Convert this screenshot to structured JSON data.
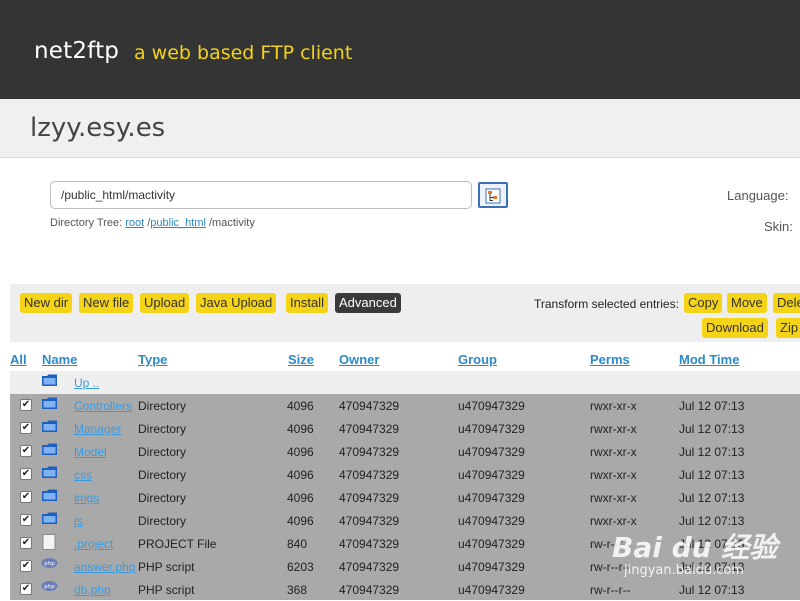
{
  "header": {
    "app_name": "net2ftp",
    "tagline": "a web based FTP client"
  },
  "host": {
    "title": "lzyy.esy.es"
  },
  "directory": {
    "path": "/public_html/mactivity",
    "tree_label": "Directory Tree:",
    "tree": [
      "root",
      "public_html",
      "/mactivity"
    ]
  },
  "settings": {
    "language_label": "Language:",
    "skin_label": "Skin:"
  },
  "toolbar": {
    "buttons": [
      "New dir",
      "New file",
      "Upload",
      "Java Upload",
      "Install",
      "Advanced"
    ],
    "transform_label": "Transform selected entries:",
    "transform_buttons": [
      "Copy",
      "Move",
      "Dele",
      "Download",
      "Zip"
    ]
  },
  "columns": [
    "All",
    "Name",
    "Type",
    "Size",
    "Owner",
    "Group",
    "Perms",
    "Mod Time"
  ],
  "up_label": "Up ..",
  "files": [
    {
      "name": "Controllers",
      "type": "Directory",
      "size": "4096",
      "owner": "470947329",
      "group": "u470947329",
      "perms": "rwxr-xr-x",
      "mtime": "Jul 12 07:13",
      "icon": "folder-icon"
    },
    {
      "name": "Manager",
      "type": "Directory",
      "size": "4096",
      "owner": "470947329",
      "group": "u470947329",
      "perms": "rwxr-xr-x",
      "mtime": "Jul 12 07:13",
      "icon": "folder-icon"
    },
    {
      "name": "Model",
      "type": "Directory",
      "size": "4096",
      "owner": "470947329",
      "group": "u470947329",
      "perms": "rwxr-xr-x",
      "mtime": "Jul 12 07:13",
      "icon": "folder-icon"
    },
    {
      "name": "css",
      "type": "Directory",
      "size": "4096",
      "owner": "470947329",
      "group": "u470947329",
      "perms": "rwxr-xr-x",
      "mtime": "Jul 12 07:13",
      "icon": "folder-icon"
    },
    {
      "name": "imgs",
      "type": "Directory",
      "size": "4096",
      "owner": "470947329",
      "group": "u470947329",
      "perms": "rwxr-xr-x",
      "mtime": "Jul 12 07:13",
      "icon": "folder-icon"
    },
    {
      "name": "js",
      "type": "Directory",
      "size": "4096",
      "owner": "470947329",
      "group": "u470947329",
      "perms": "rwxr-xr-x",
      "mtime": "Jul 12 07:13",
      "icon": "folder-icon"
    },
    {
      "name": ".project",
      "type": "PROJECT File",
      "size": "840",
      "owner": "470947329",
      "group": "u470947329",
      "perms": "rw-r--r--",
      "mtime": "Jul 12 07:13",
      "icon": "file-icon"
    },
    {
      "name": "answer.php",
      "type": "PHP script",
      "size": "6203",
      "owner": "470947329",
      "group": "u470947329",
      "perms": "rw-r--r--",
      "mtime": "Jul 12 07:13",
      "icon": "php-icon"
    },
    {
      "name": "db.php",
      "type": "PHP script",
      "size": "368",
      "owner": "470947329",
      "group": "u470947329",
      "perms": "rw-r--r--",
      "mtime": "Jul 12 07:13",
      "icon": "php-icon"
    }
  ],
  "watermark": {
    "logo": "Bai du 经验",
    "url": "jingyan.baidu.com"
  },
  "colors": {
    "header_bg": "#343434",
    "tagline": "#f2d21b",
    "button": "#f5d316",
    "link": "#2d8ac9",
    "selected_rows": "#a9a9a9"
  }
}
